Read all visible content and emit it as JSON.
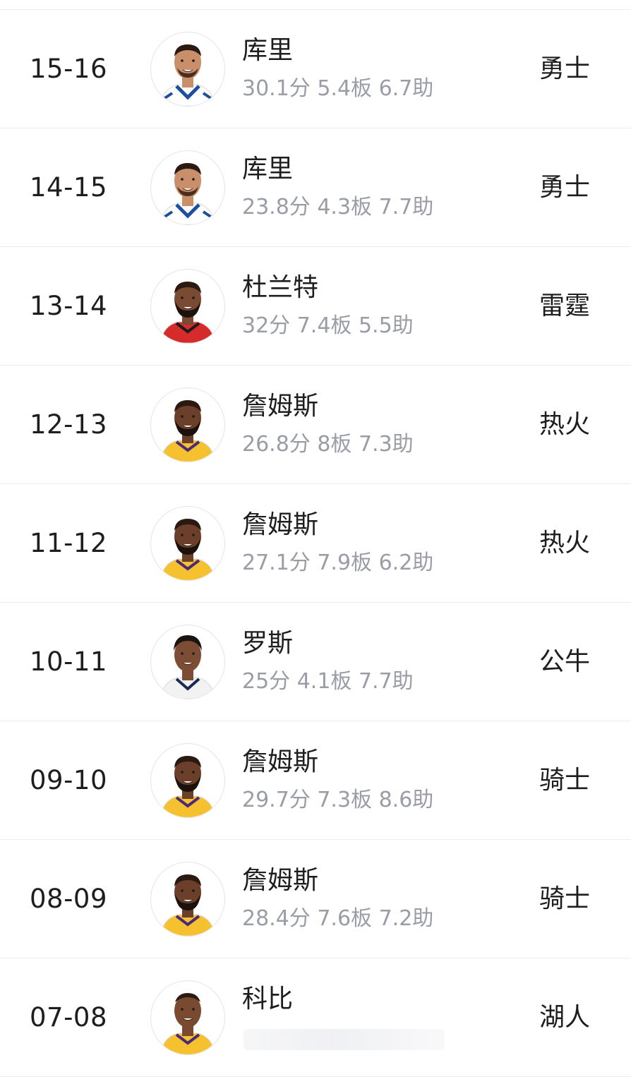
{
  "rows": [
    {
      "season": "15-16",
      "player": "库里",
      "stats": "30.1分 5.4板 6.7助",
      "team": "勇士",
      "avatar": "curry",
      "jersey": "#ffffff",
      "skin": "#c98e6a"
    },
    {
      "season": "14-15",
      "player": "库里",
      "stats": "23.8分 4.3板 7.7助",
      "team": "勇士",
      "avatar": "curry",
      "jersey": "#ffffff",
      "skin": "#c98e6a"
    },
    {
      "season": "13-14",
      "player": "杜兰特",
      "stats": "32分 7.4板 5.5助",
      "team": "雷霆",
      "avatar": "durant",
      "jersey": "#d62b2b",
      "skin": "#7a4a32"
    },
    {
      "season": "12-13",
      "player": "詹姆斯",
      "stats": "26.8分 8板 7.3助",
      "team": "热火",
      "avatar": "james",
      "jersey": "#f5c12e",
      "skin": "#6b3f2a"
    },
    {
      "season": "11-12",
      "player": "詹姆斯",
      "stats": "27.1分 7.9板 6.2助",
      "team": "热火",
      "avatar": "james",
      "jersey": "#f5c12e",
      "skin": "#6b3f2a"
    },
    {
      "season": "10-11",
      "player": "罗斯",
      "stats": "25分 4.1板 7.7助",
      "team": "公牛",
      "avatar": "rose",
      "jersey": "#f2f2f2",
      "skin": "#7c4d34"
    },
    {
      "season": "09-10",
      "player": "詹姆斯",
      "stats": "29.7分 7.3板 8.6助",
      "team": "骑士",
      "avatar": "james",
      "jersey": "#f5c12e",
      "skin": "#6b3f2a"
    },
    {
      "season": "08-09",
      "player": "詹姆斯",
      "stats": "28.4分 7.6板 7.2助",
      "team": "骑士",
      "avatar": "james",
      "jersey": "#f5c12e",
      "skin": "#6b3f2a"
    },
    {
      "season": "07-08",
      "player": "科比",
      "stats": "",
      "team": "湖人",
      "avatar": "kobe",
      "jersey": "#f5c12e",
      "skin": "#7a4a30"
    }
  ]
}
